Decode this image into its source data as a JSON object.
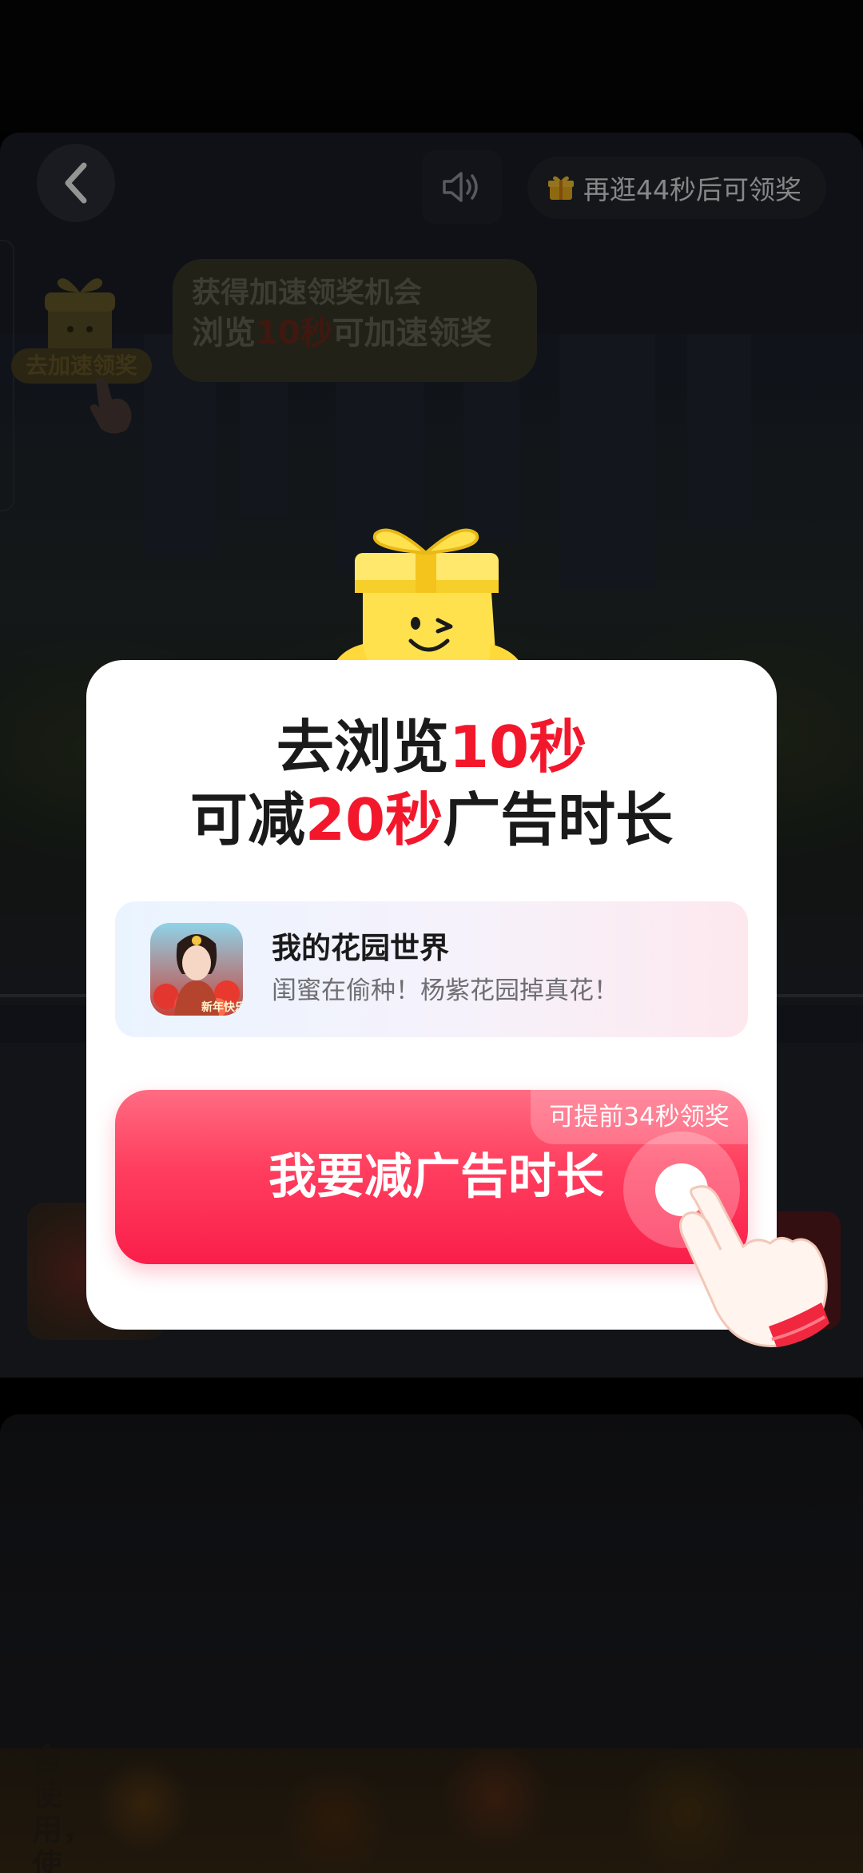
{
  "top_bar": {
    "back_icon": "chevron-left-icon",
    "sound_icon": "speaker-icon",
    "reward_timer": "再逛44秒后可领奖",
    "gift_icon": "gift-icon"
  },
  "speedup_tip": {
    "line1": "获得加速领奖机会",
    "line2_prefix": "浏览",
    "line2_highlight": "10秒",
    "line2_suffix": "可加速领奖",
    "badge": "去加速领奖"
  },
  "background": {
    "side_text": "舍使用，使"
  },
  "modal": {
    "title_line1_prefix": "去浏览",
    "title_line1_highlight": "10秒",
    "title_line2_prefix": "可减",
    "title_line2_highlight": "20秒",
    "title_line2_suffix": "广告时长",
    "app": {
      "name": "我的花园世界",
      "description": "闺蜜在偷种！杨紫花园掉真花！",
      "icon_caption": "新年快乐"
    },
    "cta": {
      "label": "我要减广告时长",
      "badge": "可提前34秒领奖"
    }
  },
  "colors": {
    "accent_red": "#f3172c",
    "cta_pink": "#ff3e5e",
    "title_dark": "#1a1a1a"
  }
}
